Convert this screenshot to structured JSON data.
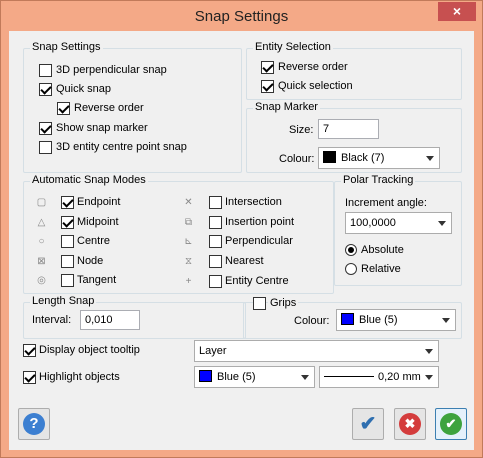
{
  "window": {
    "title": "Snap Settings",
    "close_glyph": "×"
  },
  "snap_settings": {
    "legend": "Snap Settings",
    "items": [
      {
        "label": "3D perpendicular snap",
        "checked": false
      },
      {
        "label": "Quick snap",
        "checked": true
      },
      {
        "label": "Reverse order",
        "checked": true
      },
      {
        "label": "Show snap marker",
        "checked": true
      },
      {
        "label": "3D entity centre point snap",
        "checked": false
      }
    ]
  },
  "entity_selection": {
    "legend": "Entity Selection",
    "items": [
      {
        "label": "Reverse order",
        "checked": true
      },
      {
        "label": "Quick selection",
        "checked": true
      }
    ]
  },
  "snap_marker": {
    "legend": "Snap Marker",
    "size_label": "Size:",
    "size_value": "7",
    "colour_label": "Colour:",
    "colour_value": "Black (7)",
    "colour_hex": "#000000"
  },
  "auto_snap": {
    "legend": "Automatic Snap Modes",
    "left": [
      {
        "label": "Endpoint",
        "checked": true,
        "icon": "endpoint-icon"
      },
      {
        "label": "Midpoint",
        "checked": true,
        "icon": "midpoint-icon"
      },
      {
        "label": "Centre",
        "checked": false,
        "icon": "centre-icon"
      },
      {
        "label": "Node",
        "checked": false,
        "icon": "node-icon"
      },
      {
        "label": "Tangent",
        "checked": false,
        "icon": "tangent-icon"
      }
    ],
    "right": [
      {
        "label": "Intersection",
        "checked": false,
        "icon": "intersection-icon"
      },
      {
        "label": "Insertion point",
        "checked": false,
        "icon": "insertion-point-icon"
      },
      {
        "label": "Perpendicular",
        "checked": false,
        "icon": "perpendicular-icon"
      },
      {
        "label": "Nearest",
        "checked": false,
        "icon": "nearest-icon"
      },
      {
        "label": "Entity Centre",
        "checked": false,
        "icon": "entity-centre-icon"
      }
    ]
  },
  "polar": {
    "legend": "Polar Tracking",
    "increment_label": "Increment angle:",
    "increment_value": "100,0000",
    "absolute_label": "Absolute",
    "relative_label": "Relative",
    "selected": "absolute"
  },
  "length_snap": {
    "legend": "Length Snap",
    "interval_label": "Interval:",
    "interval_value": "0,010"
  },
  "grips": {
    "label": "Grips",
    "checked": false,
    "colour_label": "Colour:",
    "colour_value": "Blue (5)",
    "colour_hex": "#0000ff"
  },
  "tooltip": {
    "label": "Display object tooltip",
    "checked": true,
    "layer_value": "Layer"
  },
  "highlight": {
    "label": "Highlight objects",
    "checked": true,
    "colour_value": "Blue (5)",
    "colour_hex": "#0000ff",
    "lineweight_value": "0,20 mm"
  },
  "buttons": {
    "help_glyph": "?",
    "ok_glyph": "✔",
    "cancel_glyph": "✖",
    "apply_glyph": "✔"
  }
}
